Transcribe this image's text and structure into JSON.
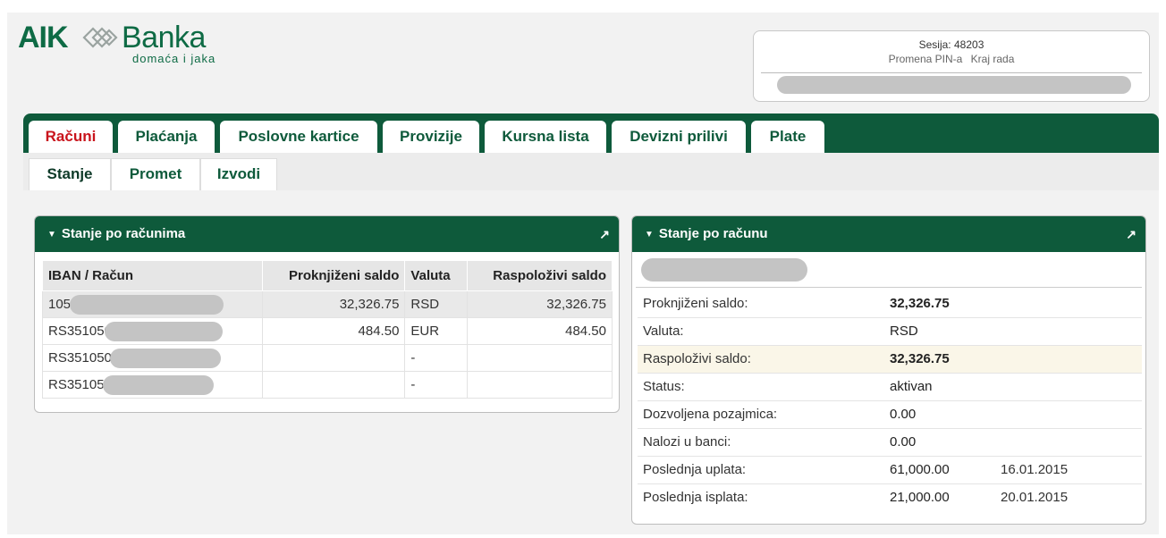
{
  "logo": {
    "brand_left": "AIK",
    "brand_right": "Banka",
    "tagline": "domaća i jaka"
  },
  "session": {
    "label": "Sesija:",
    "id": "48203",
    "change_pin": "Promena PIN-a",
    "logout": "Kraj rada"
  },
  "main_tabs": [
    {
      "label": "Računi",
      "active": true
    },
    {
      "label": "Plaćanja"
    },
    {
      "label": "Poslovne kartice"
    },
    {
      "label": "Provizije"
    },
    {
      "label": "Kursna lista"
    },
    {
      "label": "Devizni prilivi"
    },
    {
      "label": "Plate"
    }
  ],
  "sub_tabs": [
    {
      "label": "Stanje",
      "active": true
    },
    {
      "label": "Promet"
    },
    {
      "label": "Izvodi"
    }
  ],
  "accounts_panel": {
    "title": "Stanje po računima",
    "columns": [
      "IBAN / Račun",
      "Proknjiženi saldo",
      "Valuta",
      "Raspoloživi saldo"
    ],
    "rows": [
      {
        "account": "105(",
        "booked": "32,326.75",
        "currency": "RSD",
        "available": "32,326.75"
      },
      {
        "account": "RS351050",
        "booked": "484.50",
        "currency": "EUR",
        "available": "484.50"
      },
      {
        "account": "RS3510505",
        "booked": "",
        "currency": "-",
        "available": ""
      },
      {
        "account": "RS351050",
        "booked": "",
        "currency": "-",
        "available": ""
      }
    ]
  },
  "detail_panel": {
    "title": "Stanje po računu",
    "rows": [
      {
        "label": "Proknjiženi saldo:",
        "value": "32,326.75",
        "date": ""
      },
      {
        "label": "Valuta:",
        "value": "RSD",
        "date": ""
      },
      {
        "label": "Raspoloživi saldo:",
        "value": "32,326.75",
        "date": ""
      },
      {
        "label": "Status:",
        "value": "aktivan",
        "date": ""
      },
      {
        "label": "Dozvoljena pozajmica:",
        "value": "0.00",
        "date": ""
      },
      {
        "label": "Nalozi u banci:",
        "value": "0.00",
        "date": ""
      },
      {
        "label": "Poslednja uplata:",
        "value": "61,000.00",
        "date": "16.01.2015"
      },
      {
        "label": "Poslednja isplata:",
        "value": "21,000.00",
        "date": "20.01.2015"
      }
    ]
  },
  "colors": {
    "brand_green": "#0e5a3b",
    "active_tab_red": "#c9141c",
    "highlight_row": "#faf6e8"
  }
}
